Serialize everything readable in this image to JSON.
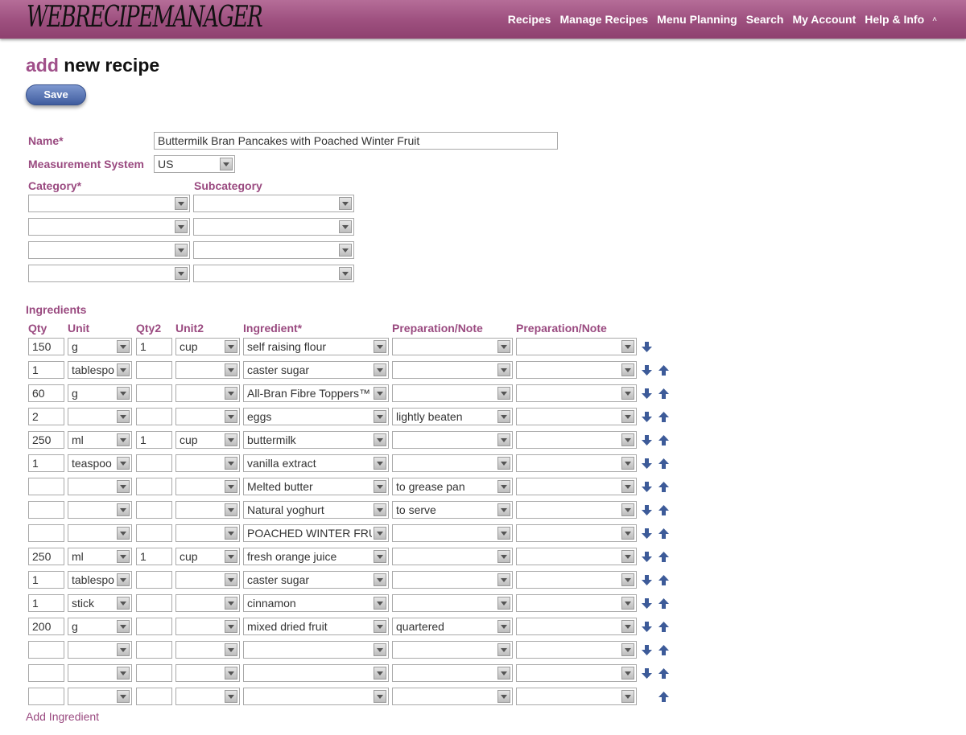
{
  "app": {
    "logo_text": "WEBRECIPEMANAGER"
  },
  "nav": {
    "items": [
      "Recipes",
      "Manage Recipes",
      "Menu Planning",
      "Search",
      "My Account",
      "Help & Info"
    ],
    "caret": "˄"
  },
  "page": {
    "title_accent": "add",
    "title_rest": "new recipe",
    "save_label": "Save"
  },
  "form": {
    "name_label": "Name*",
    "name_value": "Buttermilk Bran Pancakes with Poached Winter Fruit",
    "measurement_label": "Measurement System",
    "measurement_value": "US",
    "category_label": "Category*",
    "subcategory_label": "Subcategory",
    "category_rows": [
      {
        "category": "",
        "subcategory": ""
      },
      {
        "category": "",
        "subcategory": ""
      },
      {
        "category": "",
        "subcategory": ""
      },
      {
        "category": "",
        "subcategory": ""
      }
    ]
  },
  "ingredients": {
    "section_label": "Ingredients",
    "columns": {
      "qty": "Qty",
      "unit": "Unit",
      "qty2": "Qty2",
      "unit2": "Unit2",
      "ingredient": "Ingredient*",
      "prep1": "Preparation/Note",
      "prep2": "Preparation/Note"
    },
    "rows": [
      {
        "qty": "150",
        "unit": "g",
        "qty2": "1",
        "unit2": "cup",
        "ingredient": "self raising flour",
        "prep1": "",
        "prep2": ""
      },
      {
        "qty": "1",
        "unit": "tablespo",
        "qty2": "",
        "unit2": "",
        "ingredient": "caster sugar",
        "prep1": "",
        "prep2": ""
      },
      {
        "qty": "60",
        "unit": "g",
        "qty2": "",
        "unit2": "",
        "ingredient": "All-Bran Fibre Toppers™",
        "prep1": "",
        "prep2": ""
      },
      {
        "qty": "2",
        "unit": "",
        "qty2": "",
        "unit2": "",
        "ingredient": "eggs",
        "prep1": "lightly beaten",
        "prep2": ""
      },
      {
        "qty": "250",
        "unit": "ml",
        "qty2": "1",
        "unit2": "cup",
        "ingredient": "buttermilk",
        "prep1": "",
        "prep2": ""
      },
      {
        "qty": "1",
        "unit": "teaspoo",
        "qty2": "",
        "unit2": "",
        "ingredient": "vanilla extract",
        "prep1": "",
        "prep2": ""
      },
      {
        "qty": "",
        "unit": "",
        "qty2": "",
        "unit2": "",
        "ingredient": "Melted butter",
        "prep1": "to grease pan",
        "prep2": ""
      },
      {
        "qty": "",
        "unit": "",
        "qty2": "",
        "unit2": "",
        "ingredient": "Natural yoghurt",
        "prep1": "to serve",
        "prep2": ""
      },
      {
        "qty": "",
        "unit": "",
        "qty2": "",
        "unit2": "",
        "ingredient": "POACHED WINTER FRU",
        "prep1": "",
        "prep2": ""
      },
      {
        "qty": "250",
        "unit": "ml",
        "qty2": "1",
        "unit2": "cup",
        "ingredient": "fresh orange juice",
        "prep1": "",
        "prep2": ""
      },
      {
        "qty": "1",
        "unit": "tablespo",
        "qty2": "",
        "unit2": "",
        "ingredient": "caster sugar",
        "prep1": "",
        "prep2": ""
      },
      {
        "qty": "1",
        "unit": "stick",
        "qty2": "",
        "unit2": "",
        "ingredient": "cinnamon",
        "prep1": "",
        "prep2": ""
      },
      {
        "qty": "200",
        "unit": "g",
        "qty2": "",
        "unit2": "",
        "ingredient": "mixed dried fruit",
        "prep1": "quartered",
        "prep2": ""
      },
      {
        "qty": "",
        "unit": "",
        "qty2": "",
        "unit2": "",
        "ingredient": "",
        "prep1": "",
        "prep2": ""
      },
      {
        "qty": "",
        "unit": "",
        "qty2": "",
        "unit2": "",
        "ingredient": "",
        "prep1": "",
        "prep2": ""
      },
      {
        "qty": "",
        "unit": "",
        "qty2": "",
        "unit2": "",
        "ingredient": "",
        "prep1": "",
        "prep2": ""
      }
    ],
    "add_link": "Add Ingredient"
  },
  "colors": {
    "brand": "#9d4f7e",
    "label": "#9a4a80",
    "button": "#4a66a8",
    "arrow": "#3d5b99"
  }
}
